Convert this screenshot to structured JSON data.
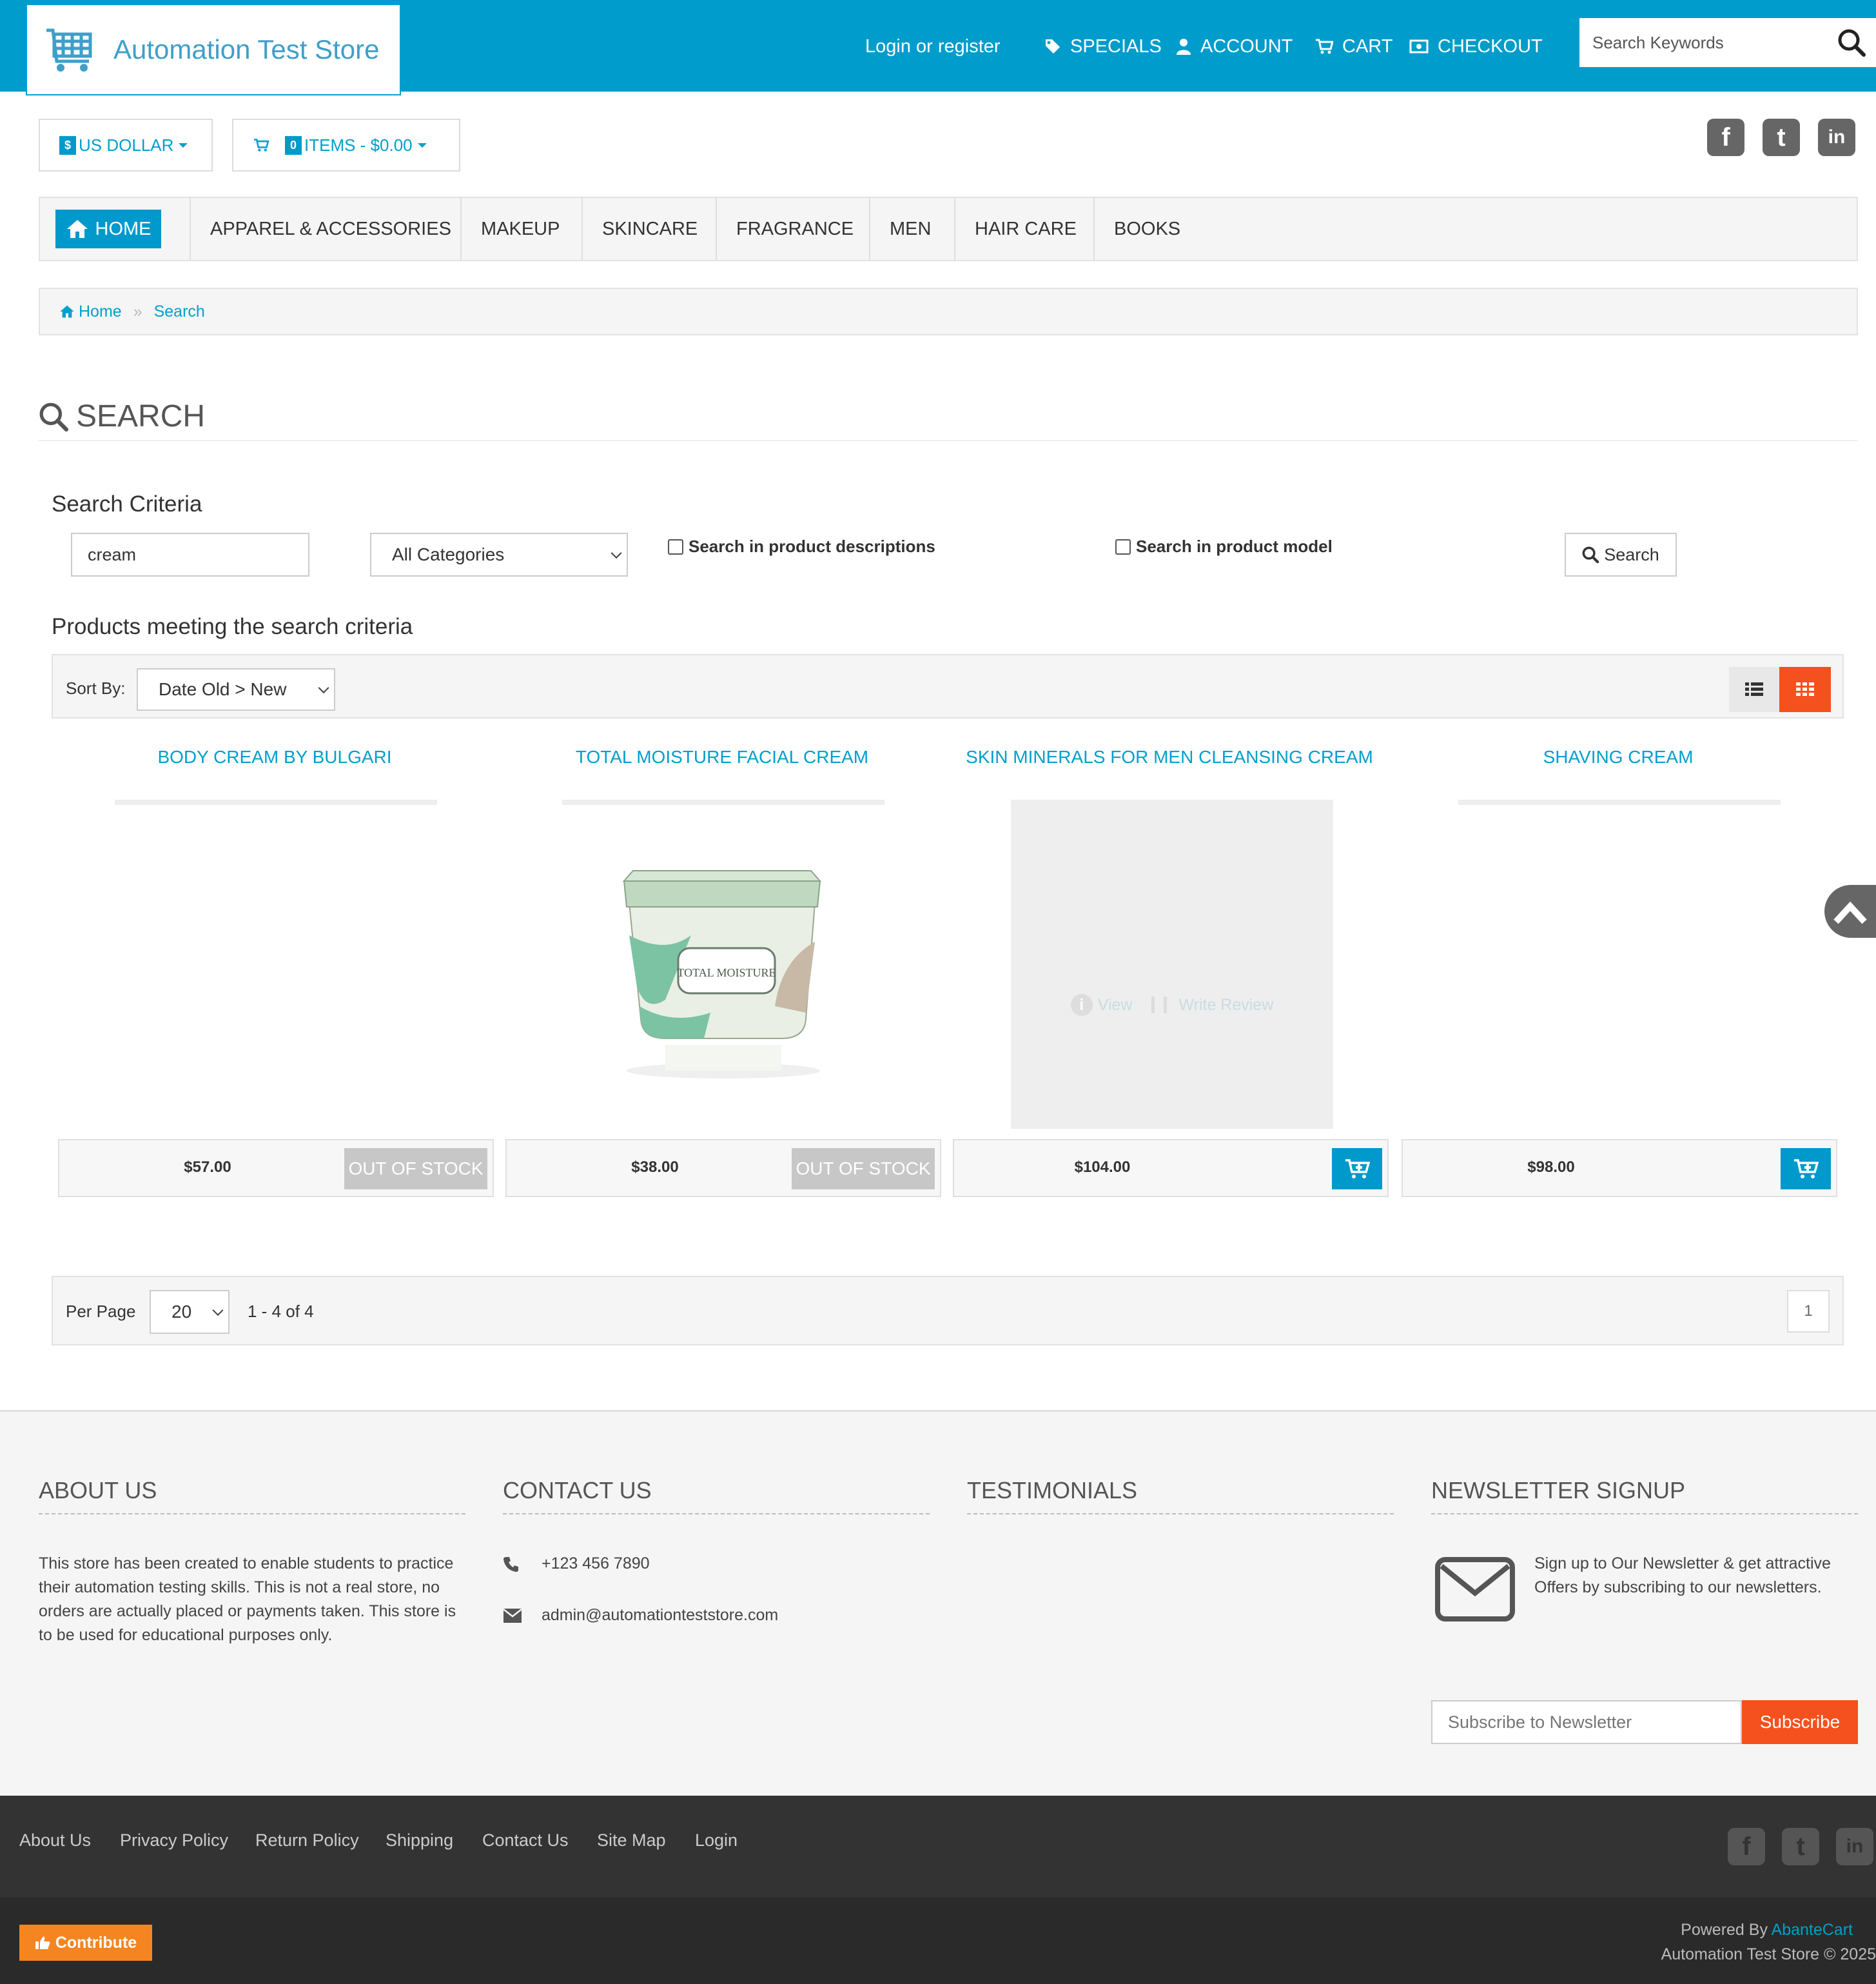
{
  "header": {
    "logo_text": "Automation Test Store",
    "login": "Login or register",
    "nav": [
      "SPECIALS",
      "ACCOUNT",
      "CART",
      "CHECKOUT"
    ],
    "search_placeholder": "Search Keywords"
  },
  "currency": {
    "label": "US DOLLAR",
    "symbol": "$"
  },
  "cart": {
    "count": "0",
    "label": "ITEMS - $0.00"
  },
  "menu": {
    "home": "HOME",
    "items": [
      "APPAREL & ACCESSORIES",
      "MAKEUP",
      "SKINCARE",
      "FRAGRANCE",
      "MEN",
      "HAIR CARE",
      "BOOKS"
    ]
  },
  "breadcrumb": {
    "home": "Home",
    "current": "Search"
  },
  "page_title": "SEARCH",
  "criteria": {
    "title": "Search Criteria",
    "keyword": "cream",
    "category": "All Categories",
    "desc_label": "Search in product descriptions",
    "model_label": "Search in product model",
    "button": "Search"
  },
  "results": {
    "title": "Products meeting the search criteria",
    "sort_label": "Sort By:",
    "sort_value": "Date Old > New",
    "products": [
      {
        "name": "BODY CREAM BY BULGARI",
        "price": "$57.00",
        "status": "OUT OF STOCK"
      },
      {
        "name": "TOTAL MOISTURE FACIAL CREAM",
        "price": "$38.00",
        "status": "OUT OF STOCK",
        "image_text": "TOTAL MOISTURE"
      },
      {
        "name": "SKIN MINERALS FOR MEN CLEANSING CREAM",
        "price": "$104.00",
        "status": "",
        "hover_view": "View",
        "hover_review": "Write Review"
      },
      {
        "name": "SHAVING CREAM",
        "price": "$98.00",
        "status": ""
      }
    ],
    "per_page_label": "Per Page",
    "per_page": "20",
    "range": "1 - 4 of 4",
    "page": "1"
  },
  "footer": {
    "about_title": "ABOUT US",
    "about_text": "This store has been created to enable students to practice their automation testing skills. This is not a real store, no orders are actually placed or payments taken. This store is to be used for educational purposes only.",
    "contact_title": "CONTACT US",
    "phone": "+123 456 7890",
    "email": "admin@automationteststore.com",
    "testimonials_title": "TESTIMONIALS",
    "newsletter_title": "NEWSLETTER SIGNUP",
    "newsletter_text": "Sign up to Our Newsletter & get attractive Offers by subscribing to our newsletters.",
    "subscribe_placeholder": "Subscribe to Newsletter",
    "subscribe_button": "Subscribe",
    "links": [
      "About Us",
      "Privacy Policy",
      "Return Policy",
      "Shipping",
      "Contact Us",
      "Site Map",
      "Login"
    ],
    "contribute": "Contribute",
    "powered_by": "Powered By",
    "powered_link": "AbanteCart",
    "copyright": "Automation Test Store © 2025"
  },
  "colors": {
    "brand": "#009ccc",
    "accent": "#f4511e",
    "dark": "#333333"
  }
}
